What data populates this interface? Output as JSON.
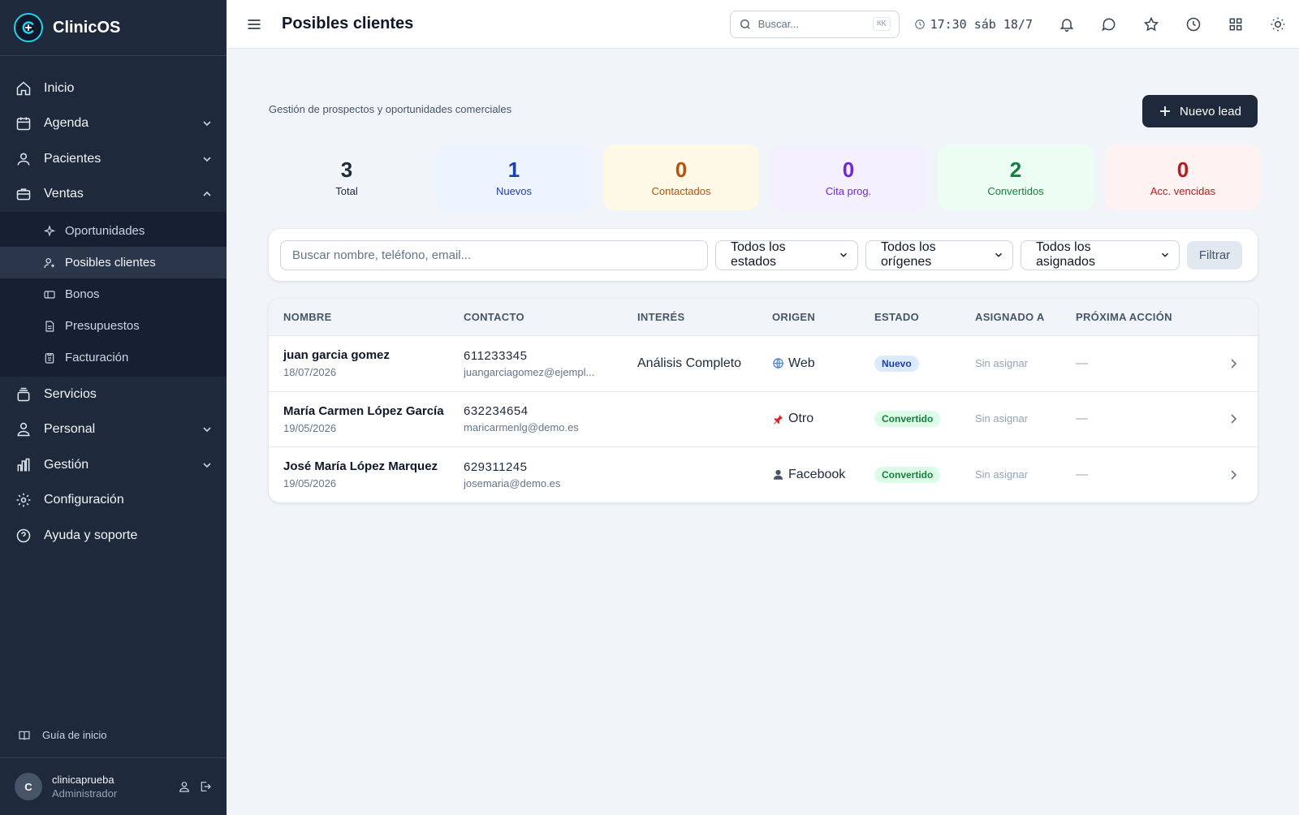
{
  "app": {
    "name": "ClinicOS"
  },
  "sidebar": {
    "items": [
      {
        "label": "Inicio",
        "icon": "home-icon"
      },
      {
        "label": "Agenda",
        "icon": "calendar-icon"
      },
      {
        "label": "Pacientes",
        "icon": "users-icon"
      },
      {
        "label": "Ventas",
        "icon": "briefcase-icon"
      },
      {
        "label": "Servicios",
        "icon": "layers-icon"
      },
      {
        "label": "Personal",
        "icon": "user-group-icon"
      },
      {
        "label": "Gestión",
        "icon": "bar-chart-icon"
      },
      {
        "label": "Configuración",
        "icon": "gear-icon"
      },
      {
        "label": "Ayuda y soporte",
        "icon": "help-icon"
      }
    ],
    "ventas_sub": [
      {
        "label": "Oportunidades",
        "icon": "sparkle-icon"
      },
      {
        "label": "Posibles clientes",
        "icon": "user-plus-icon"
      },
      {
        "label": "Bonos",
        "icon": "ticket-icon"
      },
      {
        "label": "Presupuestos",
        "icon": "document-icon"
      },
      {
        "label": "Facturación",
        "icon": "clipboard-icon"
      }
    ],
    "guide": "Guía de inicio",
    "user": {
      "initial": "C",
      "name": "clinicaprueba",
      "role": "Administrador"
    }
  },
  "topbar": {
    "title": "Posibles clientes",
    "search_placeholder": "Buscar...",
    "shortcut": "⌘K",
    "time": "17:30",
    "date": "sáb 18/7"
  },
  "main": {
    "subtitle": "Gestión de prospectos y oportunidades comerciales",
    "new_button": "Nuevo lead",
    "stats": [
      {
        "value": "3",
        "label": "Total",
        "bg": "#f1f5f9",
        "color": "#1e293b"
      },
      {
        "value": "1",
        "label": "Nuevos",
        "bg": "#eef4ff",
        "color": "#1e40af"
      },
      {
        "value": "0",
        "label": "Contactados",
        "bg": "#fef9e7",
        "color": "#b45309"
      },
      {
        "value": "0",
        "label": "Cita prog.",
        "bg": "#f5f0ff",
        "color": "#6d28d9"
      },
      {
        "value": "2",
        "label": "Convertidos",
        "bg": "#ecfdf3",
        "color": "#15803d"
      },
      {
        "value": "0",
        "label": "Acc. vencidas",
        "bg": "#fef2f2",
        "color": "#b91c1c"
      }
    ],
    "filters": {
      "search_placeholder": "Buscar nombre, teléfono, email...",
      "estado": "Todos los estados",
      "origen": "Todos los orígenes",
      "asignado": "Todos los asignados",
      "button": "Filtrar"
    },
    "table": {
      "headers": [
        "NOMBRE",
        "CONTACTO",
        "INTERÉS",
        "ORIGEN",
        "ESTADO",
        "ASIGNADO A",
        "PRÓXIMA ACCIÓN"
      ],
      "rows": [
        {
          "name": "juan garcia gomez",
          "date": "18/07/2026",
          "phone": "611233345",
          "email": "juangarciagomez@ejempl...",
          "interest": "Análisis Completo",
          "origin": "Web",
          "origin_icon": "globe-icon",
          "status": "Nuevo",
          "status_bg": "#dbeafe",
          "status_color": "#1e40af",
          "assigned": "Sin asignar",
          "next": "—"
        },
        {
          "name": "María Carmen López García",
          "date": "19/05/2026",
          "phone": "632234654",
          "email": "maricarmenlg@demo.es",
          "interest": "",
          "origin": "Otro",
          "origin_icon": "pin-icon",
          "status": "Convertido",
          "status_bg": "#dcfce7",
          "status_color": "#15803d",
          "assigned": "Sin asignar",
          "next": "—"
        },
        {
          "name": "José María López Marquez",
          "date": "19/05/2026",
          "phone": "629311245",
          "email": "josemaria@demo.es",
          "interest": "",
          "origin": "Facebook",
          "origin_icon": "person-icon",
          "status": "Convertido",
          "status_bg": "#dcfce7",
          "status_color": "#15803d",
          "assigned": "Sin asignar",
          "next": "—"
        }
      ]
    }
  }
}
